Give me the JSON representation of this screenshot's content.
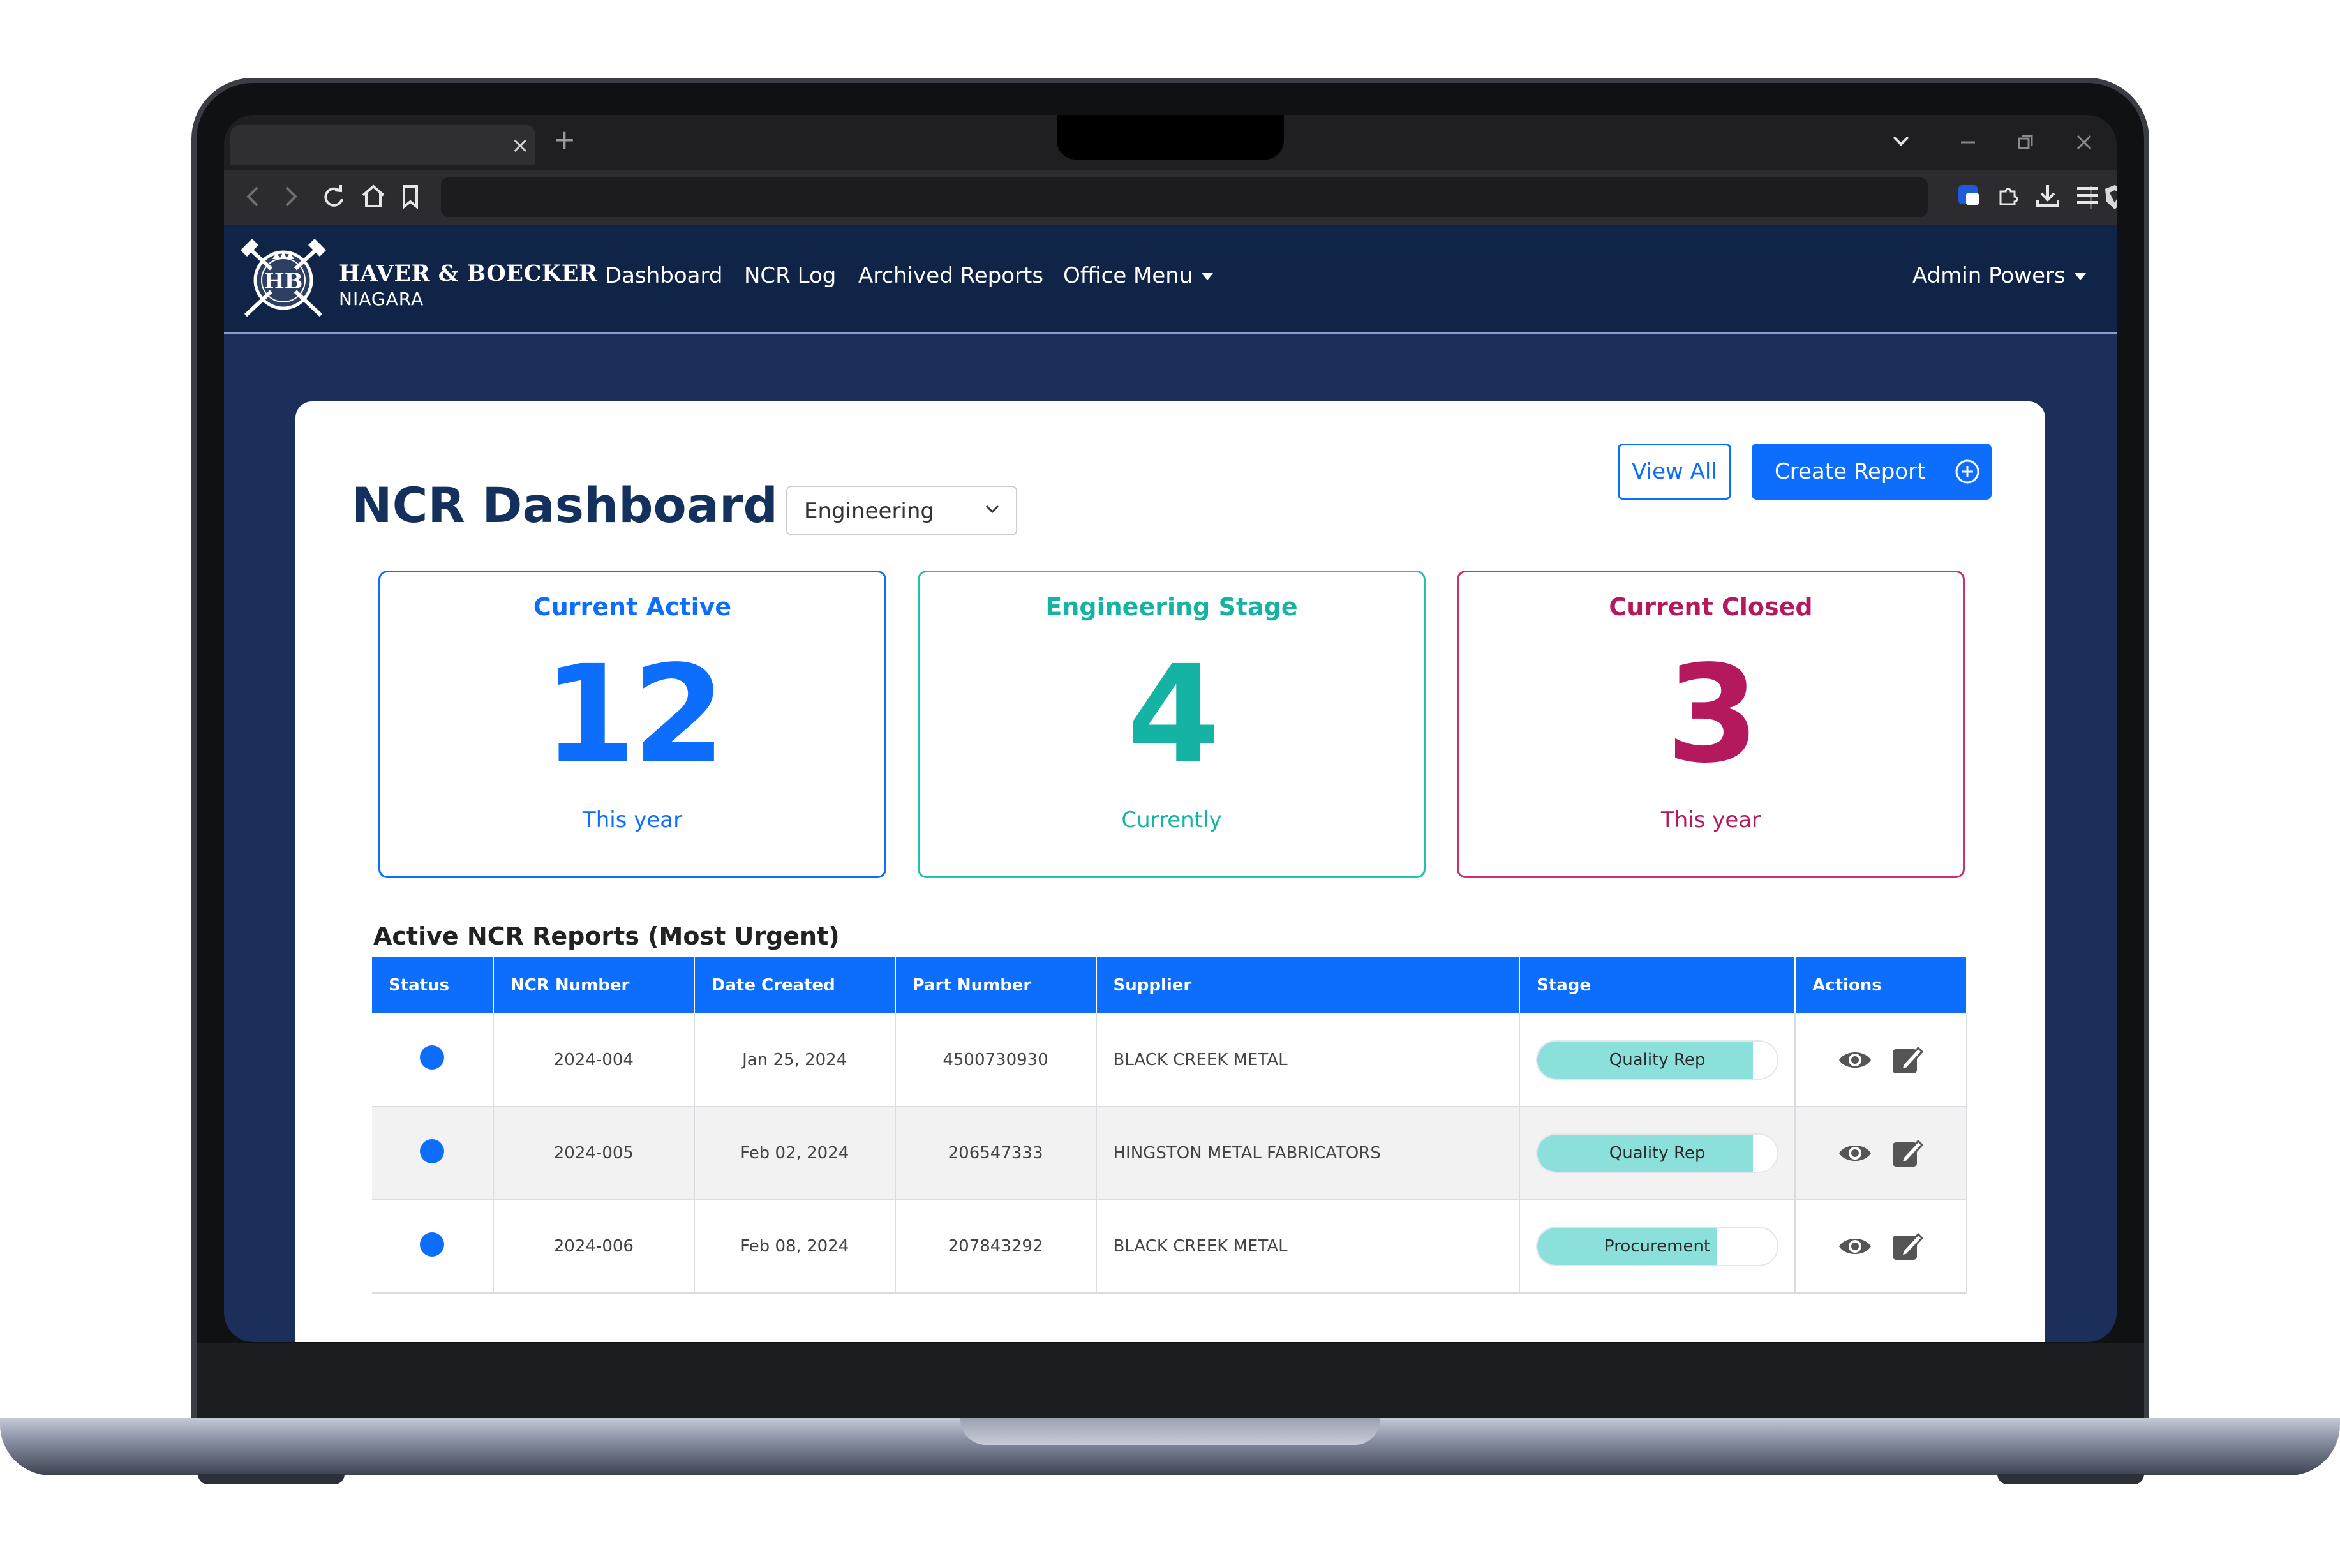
{
  "browser": {
    "tab_close": "×",
    "new_tab": "+"
  },
  "nav": {
    "brand_name": "HAVER & BOECKER",
    "brand_sub": "NIAGARA",
    "links": [
      "Dashboard",
      "NCR Log",
      "Archived Reports",
      "Office Menu"
    ],
    "user": "Admin Powers"
  },
  "header": {
    "title": "NCR Dashboard",
    "department_selected": "Engineering",
    "view_all": "View All",
    "create_report": "Create Report"
  },
  "stats": [
    {
      "title": "Current Active",
      "value": "12",
      "subtitle": "This year",
      "color": "#0d6efd"
    },
    {
      "title": "Engineering Stage",
      "value": "4",
      "subtitle": "Currently",
      "color": "#15b3a3"
    },
    {
      "title": "Current Closed",
      "value": "3",
      "subtitle": "This year",
      "color": "#b5195d"
    }
  ],
  "table": {
    "title": "Active NCR Reports (Most Urgent)",
    "columns": [
      "Status",
      "NCR Number",
      "Date Created",
      "Part Number",
      "Supplier",
      "Stage",
      "Actions"
    ],
    "rows": [
      {
        "ncr": "2024-004",
        "date": "Jan 25, 2024",
        "part": "4500730930",
        "supplier": "BLACK CREEK METAL",
        "stage": "Quality Rep",
        "progress": 0.9
      },
      {
        "ncr": "2024-005",
        "date": "Feb 02, 2024",
        "part": "206547333",
        "supplier": "HINGSTON METAL FABRICATORS",
        "stage": "Quality Rep",
        "progress": 0.9
      },
      {
        "ncr": "2024-006",
        "date": "Feb 08, 2024",
        "part": "207843292",
        "supplier": "BLACK CREEK METAL",
        "stage": "Procurement",
        "progress": 0.75
      }
    ]
  },
  "colors": {
    "nav_bg": "#0f2447",
    "page_bg": "#1b2f5a",
    "primary": "#0d6efd",
    "stage_fill": "#8ce0dc"
  }
}
